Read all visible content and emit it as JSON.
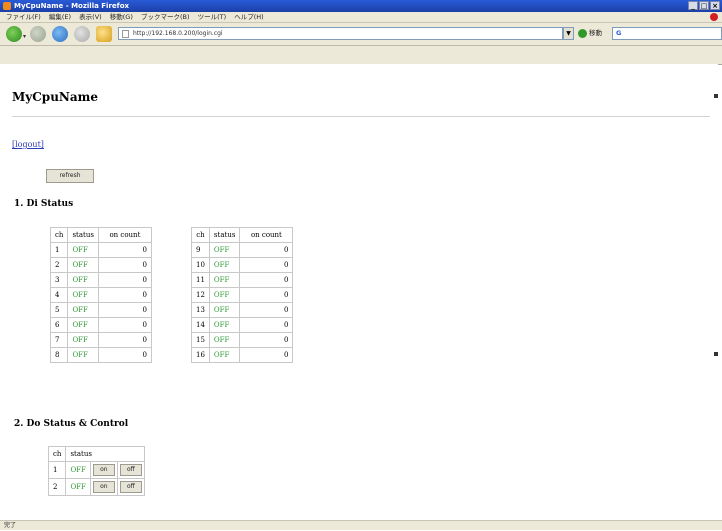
{
  "window": {
    "title": "MyCpuName - Mozilla Firefox",
    "controls": [
      "_",
      "□",
      "×"
    ]
  },
  "menu": [
    "ファイル(F)",
    "編集(E)",
    "表示(V)",
    "移動(G)",
    "ブックマーク(B)",
    "ツール(T)",
    "ヘルプ(H)"
  ],
  "nav": {
    "url": "http://192.168.0.200/login.cgi",
    "go_label": "移動",
    "search_value": "G"
  },
  "page": {
    "title": "MyCpuName",
    "logout_label": "[logout]",
    "refresh_label": "refresh",
    "di_heading": "1. Di Status",
    "do_heading": "2. Do Status & Control",
    "di_headers": [
      "ch",
      "status",
      "on count"
    ],
    "di_left": [
      {
        "ch": "1",
        "status": "OFF",
        "count": "0"
      },
      {
        "ch": "2",
        "status": "OFF",
        "count": "0"
      },
      {
        "ch": "3",
        "status": "OFF",
        "count": "0"
      },
      {
        "ch": "4",
        "status": "OFF",
        "count": "0"
      },
      {
        "ch": "5",
        "status": "OFF",
        "count": "0"
      },
      {
        "ch": "6",
        "status": "OFF",
        "count": "0"
      },
      {
        "ch": "7",
        "status": "OFF",
        "count": "0"
      },
      {
        "ch": "8",
        "status": "OFF",
        "count": "0"
      }
    ],
    "di_right": [
      {
        "ch": "9",
        "status": "OFF",
        "count": "0"
      },
      {
        "ch": "10",
        "status": "OFF",
        "count": "0"
      },
      {
        "ch": "11",
        "status": "OFF",
        "count": "0"
      },
      {
        "ch": "12",
        "status": "OFF",
        "count": "0"
      },
      {
        "ch": "13",
        "status": "OFF",
        "count": "0"
      },
      {
        "ch": "14",
        "status": "OFF",
        "count": "0"
      },
      {
        "ch": "15",
        "status": "OFF",
        "count": "0"
      },
      {
        "ch": "16",
        "status": "OFF",
        "count": "0"
      }
    ],
    "do_headers": [
      "ch",
      "status"
    ],
    "do_rows": [
      {
        "ch": "1",
        "status": "OFF",
        "on_label": "on",
        "off_label": "off"
      },
      {
        "ch": "2",
        "status": "OFF",
        "on_label": "on",
        "off_label": "off"
      }
    ]
  },
  "statusbar": {
    "text": "完了"
  }
}
